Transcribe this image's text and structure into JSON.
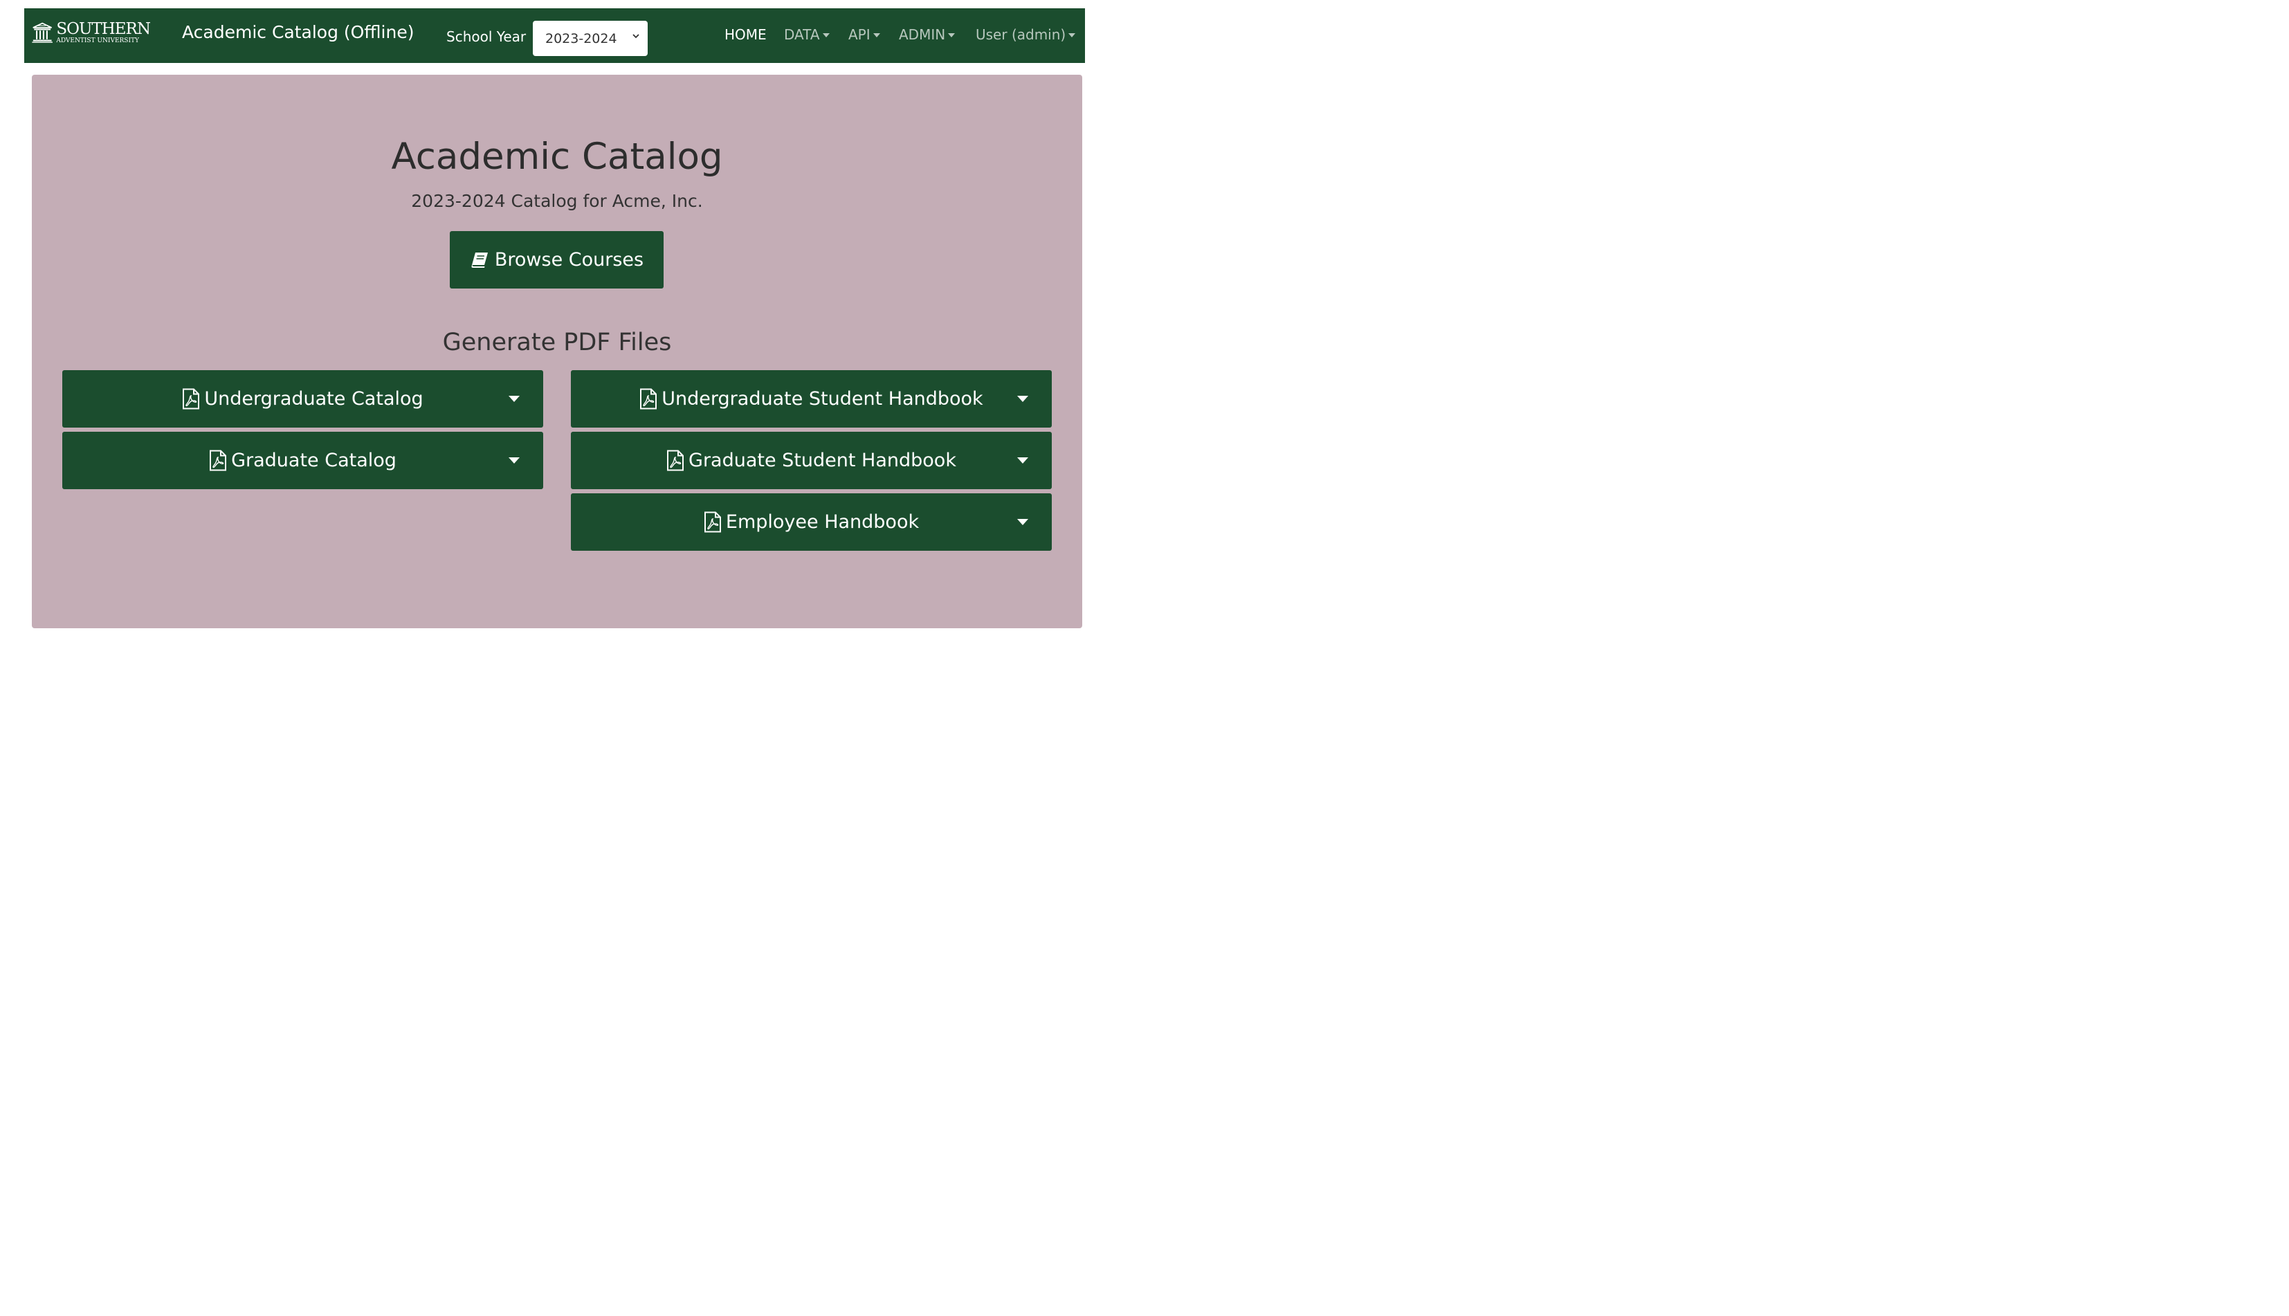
{
  "navbar": {
    "logo": {
      "main": "SOUTHERN",
      "sub": "ADVENTIST UNIVERSITY"
    },
    "brand": "Academic Catalog (Offline)",
    "school_year_label": "School Year",
    "school_year_value": "2023-2024",
    "items": [
      {
        "label": "HOME",
        "dropdown": false,
        "active": true
      },
      {
        "label": "DATA",
        "dropdown": true,
        "active": false
      },
      {
        "label": "API",
        "dropdown": true,
        "active": false
      },
      {
        "label": "ADMIN",
        "dropdown": true,
        "active": false
      },
      {
        "label": "User (admin)",
        "dropdown": true,
        "active": false
      }
    ]
  },
  "main": {
    "title": "Academic Catalog",
    "subtitle": "2023-2024 Catalog for Acme, Inc.",
    "browse_label": "Browse Courses",
    "browse_icon": "book-icon",
    "pdf_heading": "Generate PDF Files",
    "pdf_icon": "file-pdf-icon",
    "pdf_buttons": [
      {
        "label": "Undergraduate Catalog"
      },
      {
        "label": "Graduate Catalog"
      },
      {
        "label": "Undergraduate Student Handbook"
      },
      {
        "label": "Graduate Student Handbook"
      },
      {
        "label": "Employee Handbook"
      }
    ]
  },
  "colors": {
    "navbar_bg": "#1b4d2e",
    "panel_bg": "#c4adb6",
    "button_bg": "#1b4d2e",
    "nav_muted": "#b7c7bd"
  }
}
